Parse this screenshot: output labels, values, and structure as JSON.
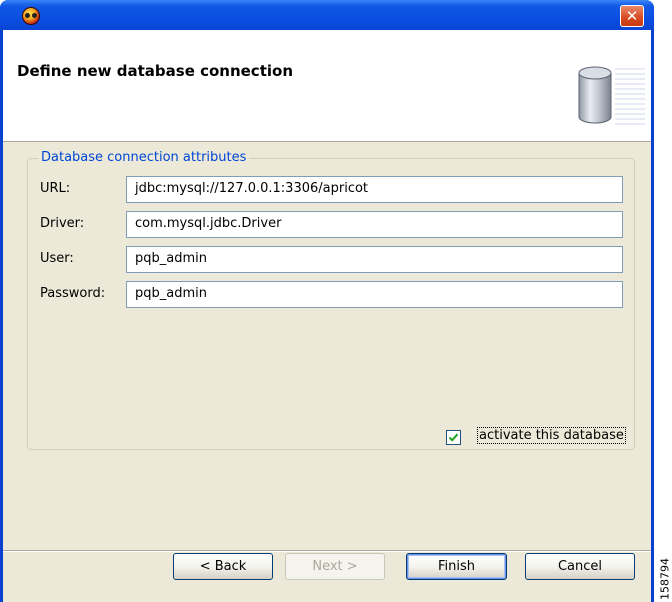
{
  "window": {
    "title": "",
    "close_glyph": "✕"
  },
  "header": {
    "title": "Define new database connection",
    "icon": "database-cylinder-icon"
  },
  "group": {
    "legend": "Database connection attributes",
    "fields": [
      {
        "label": "URL:",
        "value": "jdbc:mysql://127.0.0.1:3306/apricot"
      },
      {
        "label": "Driver:",
        "value": "com.mysql.jdbc.Driver"
      },
      {
        "label": "User:",
        "value": "pqb_admin"
      },
      {
        "label": "Password:",
        "value": "pqb_admin"
      }
    ]
  },
  "activate": {
    "checked": true,
    "label": "activate this database"
  },
  "buttons": {
    "back": "< Back",
    "next": "Next >",
    "finish": "Finish",
    "cancel": "Cancel"
  },
  "figure_number": "158794",
  "colors": {
    "titlebar": "#0a4fe0",
    "dialog_bg": "#ece9d8",
    "legend_text": "#0046d5",
    "close_button": "#d84a1f"
  }
}
